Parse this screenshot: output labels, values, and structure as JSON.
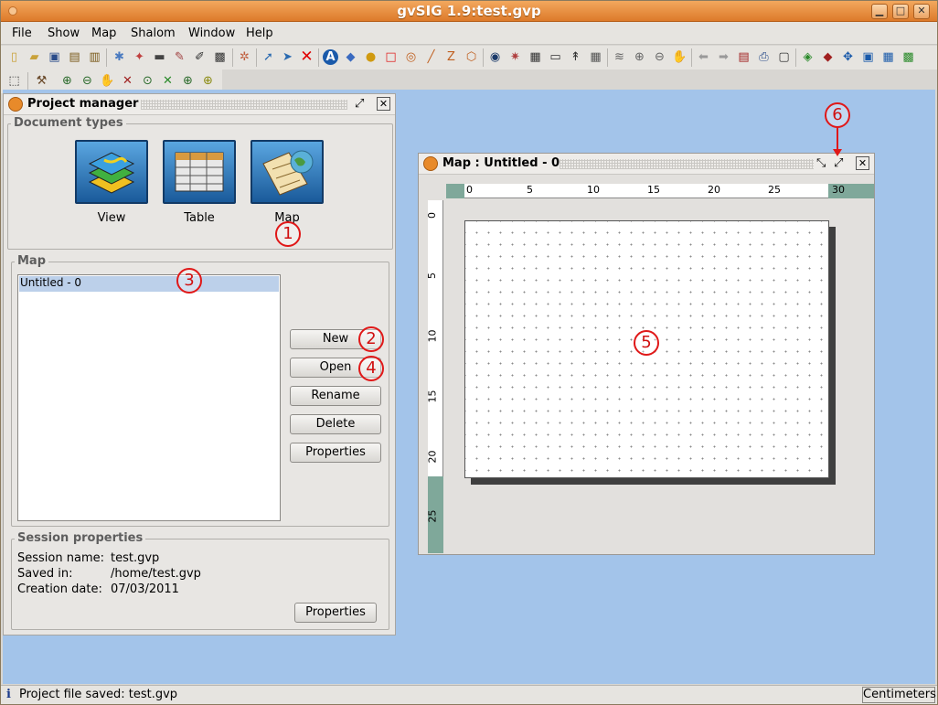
{
  "window": {
    "title": "gvSIG 1.9:test.gvp"
  },
  "menu": [
    "File",
    "Show",
    "Map",
    "Shalom",
    "Window",
    "Help"
  ],
  "project_manager": {
    "title": "Project manager",
    "document_types_legend": "Document types",
    "doc_types": [
      {
        "label": "View",
        "icon": "view-layers-icon"
      },
      {
        "label": "Table",
        "icon": "table-grid-icon"
      },
      {
        "label": "Map",
        "icon": "map-globe-icon"
      }
    ],
    "map_legend": "Map",
    "map_items": [
      "Untitled - 0"
    ],
    "buttons": {
      "new": "New",
      "open": "Open",
      "rename": "Rename",
      "delete": "Delete",
      "properties": "Properties"
    },
    "session": {
      "legend": "Session properties",
      "labels": {
        "name": "Session name:",
        "saved": "Saved in:",
        "created": "Creation date:"
      },
      "values": {
        "name": "test.gvp",
        "saved": "/home/test.gvp",
        "created": "07/03/2011"
      },
      "properties_button": "Properties"
    }
  },
  "map_window": {
    "title": "Map : Untitled - 0",
    "ruler_h": [
      "0",
      "5",
      "10",
      "15",
      "20",
      "25",
      "30"
    ],
    "ruler_v": [
      "0",
      "5",
      "10",
      "15",
      "20",
      "25"
    ]
  },
  "callouts": [
    "1",
    "2",
    "3",
    "4",
    "5",
    "6"
  ],
  "status": {
    "message": "Project file saved: test.gvp",
    "units": "Centimeters"
  },
  "colors": {
    "titlebar": "#e98d3c",
    "desktop": "#a3c4ea",
    "selection": "#bcd0ea",
    "callout": "#e01818"
  }
}
